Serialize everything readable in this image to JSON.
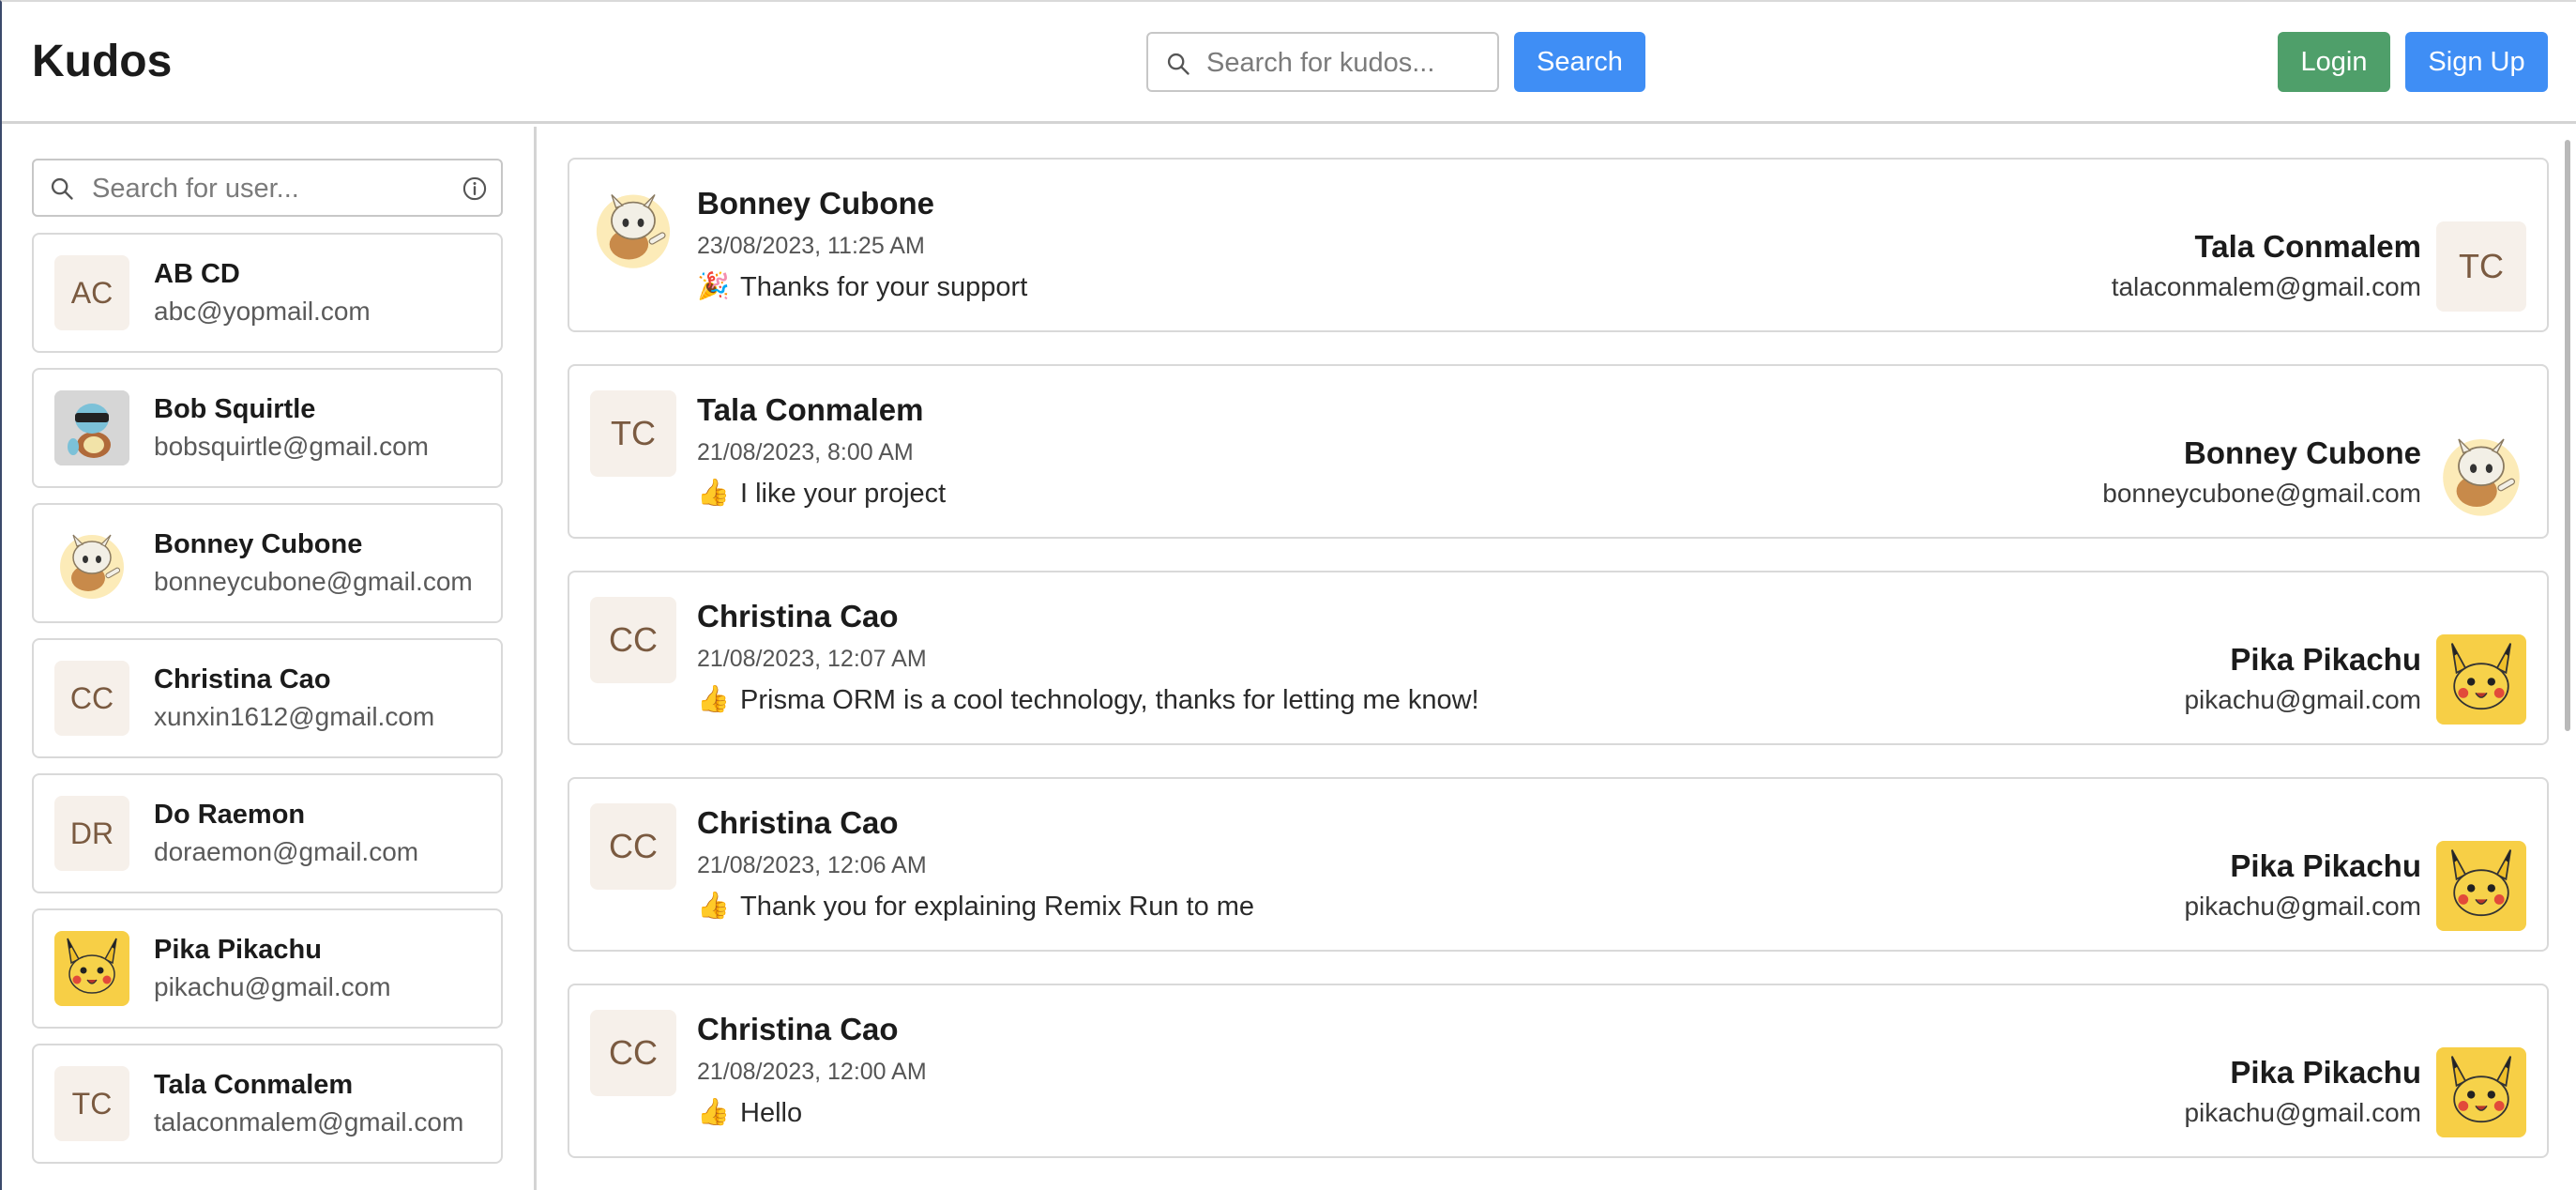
{
  "header": {
    "brand": "Kudos",
    "search_placeholder": "Search for kudos...",
    "search_button": "Search",
    "login_button": "Login",
    "signup_button": "Sign Up"
  },
  "sidebar": {
    "search_placeholder": "Search for user...",
    "users": [
      {
        "initials": "AC",
        "name": "AB CD",
        "email": "abc@yopmail.com",
        "avatar": "initials"
      },
      {
        "initials": "",
        "name": "Bob Squirtle",
        "email": "bobsquirtle@gmail.com",
        "avatar": "squirtle"
      },
      {
        "initials": "",
        "name": "Bonney Cubone",
        "email": "bonneycubone@gmail.com",
        "avatar": "cubone"
      },
      {
        "initials": "CC",
        "name": "Christina Cao",
        "email": "xunxin1612@gmail.com",
        "avatar": "initials"
      },
      {
        "initials": "DR",
        "name": "Do Raemon",
        "email": "doraemon@gmail.com",
        "avatar": "initials"
      },
      {
        "initials": "",
        "name": "Pika Pikachu",
        "email": "pikachu@gmail.com",
        "avatar": "pikachu"
      },
      {
        "initials": "TC",
        "name": "Tala Conmalem",
        "email": "talaconmalem@gmail.com",
        "avatar": "initials"
      }
    ]
  },
  "feed": {
    "kudos": [
      {
        "author": "Bonney Cubone",
        "author_avatar": "cubone",
        "author_initials": "",
        "time": "23/08/2023, 11:25 AM",
        "emoji": "🎉",
        "message": "Thanks for your support",
        "recipient": "Tala Conmalem",
        "recipient_email": "talaconmalem@gmail.com",
        "recipient_avatar": "initials",
        "recipient_initials": "TC"
      },
      {
        "author": "Tala Conmalem",
        "author_avatar": "initials",
        "author_initials": "TC",
        "time": "21/08/2023, 8:00 AM",
        "emoji": "👍",
        "message": "I like your project",
        "recipient": "Bonney Cubone",
        "recipient_email": "bonneycubone@gmail.com",
        "recipient_avatar": "cubone",
        "recipient_initials": ""
      },
      {
        "author": "Christina Cao",
        "author_avatar": "initials",
        "author_initials": "CC",
        "time": "21/08/2023, 12:07 AM",
        "emoji": "👍",
        "message": "Prisma ORM is a cool technology, thanks for letting me know!",
        "recipient": "Pika Pikachu",
        "recipient_email": "pikachu@gmail.com",
        "recipient_avatar": "pikachu",
        "recipient_initials": ""
      },
      {
        "author": "Christina Cao",
        "author_avatar": "initials",
        "author_initials": "CC",
        "time": "21/08/2023, 12:06 AM",
        "emoji": "👍",
        "message": "Thank you for explaining Remix Run to me",
        "recipient": "Pika Pikachu",
        "recipient_email": "pikachu@gmail.com",
        "recipient_avatar": "pikachu",
        "recipient_initials": ""
      },
      {
        "author": "Christina Cao",
        "author_avatar": "initials",
        "author_initials": "CC",
        "time": "21/08/2023, 12:00 AM",
        "emoji": "👍",
        "message": "Hello",
        "recipient": "Pika Pikachu",
        "recipient_email": "pikachu@gmail.com",
        "recipient_avatar": "pikachu",
        "recipient_initials": ""
      }
    ]
  },
  "colors": {
    "primary": "#3f8ef5",
    "success": "#4f9f6a",
    "avatar_bg": "#f6f0ea",
    "pikachu_bg": "#f7cf46"
  },
  "icons": {
    "search": "magnifier-icon",
    "info": "info-circle-icon"
  }
}
